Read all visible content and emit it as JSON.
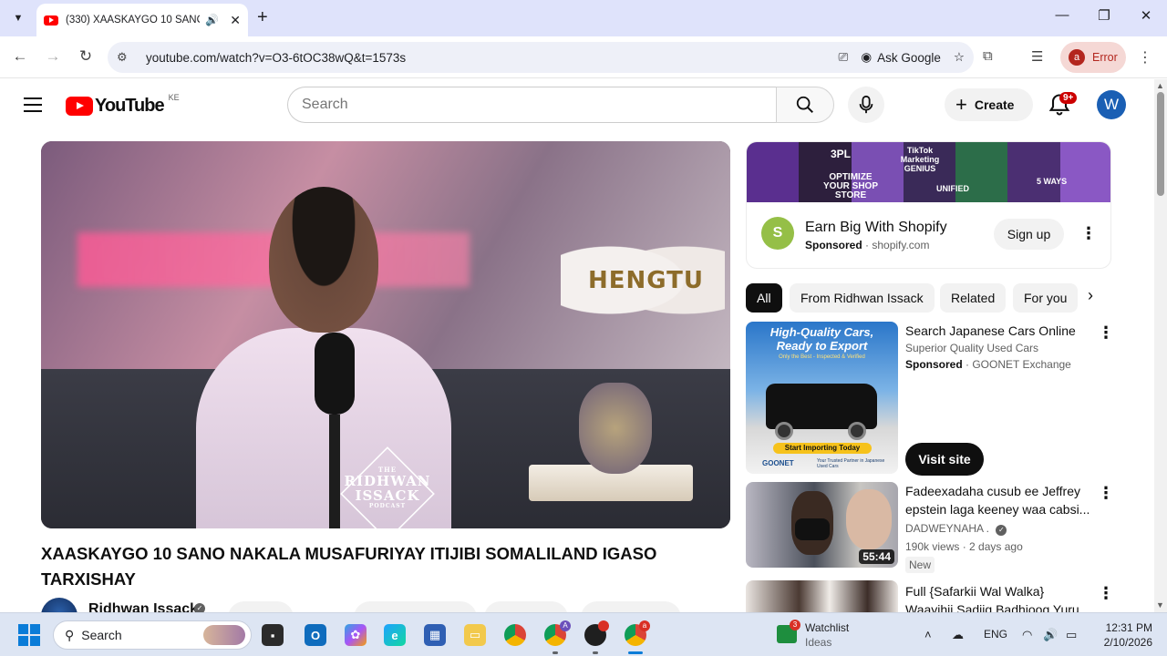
{
  "browser": {
    "tab_title": "(330) XAASKAYGO 10 SANO",
    "url": "youtube.com/watch?v=O3-6tOC38wQ&t=1573s",
    "ask_google_label": "Ask Google",
    "profile_letter": "a",
    "profile_status": "Error"
  },
  "header": {
    "logo_text": "YouTube",
    "country_code": "KE",
    "search_placeholder": "Search",
    "create_label": "Create",
    "notif_count": "9+",
    "avatar_letter": "W"
  },
  "video": {
    "title": "XAASKAYGO 10 SANO NAKALA MUSAFURIYAY ITIJIBI SOMALILAND IGASO TARXISHAY",
    "channel_name": "Ridhwan Issack",
    "overlay_glove_text": "HENGTU",
    "overlay_logo": {
      "line1": "THE",
      "line2": "RIDHWAN",
      "line3": "ISSACK",
      "line4": "PODCAST"
    }
  },
  "ad": {
    "title": "Earn Big With Shopify",
    "sponsored_label": "Sponsored",
    "domain": "shopify.com",
    "cta_label": "Sign up",
    "banner_labels": [
      "3PL",
      "TikTok Marketing GENIUS",
      "OPTIMIZE YOUR SHOP STORE",
      "UNIFIED",
      "5 WAYS"
    ]
  },
  "chips": [
    "All",
    "From Ridhwan Issack",
    "Related",
    "For you"
  ],
  "recommendations": [
    {
      "title": "Search Japanese Cars Online",
      "line1": "Superior Quality Used Cars",
      "sponsored_label": "Sponsored",
      "advertiser": "GOONET Exchange",
      "cta_label": "Visit site",
      "thumb_heading": "High-Quality Cars, Ready to Export",
      "thumb_sub": "Only the Best - Inspected & Verified",
      "thumb_button": "Start Importing Today",
      "thumb_brand": "GOONET",
      "thumb_tagline": "Your Trusted Partner in Japanese Used Cars"
    },
    {
      "title": "Fadeexadaha cusub ee Jeffrey epstein laga keeney waa cabsi...",
      "channel": "DADWEYNAHA .",
      "views": "190k views",
      "age": "2 days ago",
      "duration": "55:44",
      "badge": "New"
    },
    {
      "title": "Full {Safarkii Wal Walka} Waayihii Sadiiq Badhioog Yuru..."
    }
  ],
  "taskbar": {
    "search_placeholder": "Search",
    "watchlist_title": "Watchlist",
    "watchlist_sub": "Ideas",
    "watchlist_badge": "3",
    "language": "ENG",
    "time": "12:31 PM",
    "date": "2/10/2026"
  },
  "colors": {
    "youtube_red": "#ff0000",
    "tabstrip": "#dfe3fb",
    "error_chip": "#f5d8d5",
    "shopify_green": "#95bf47"
  }
}
